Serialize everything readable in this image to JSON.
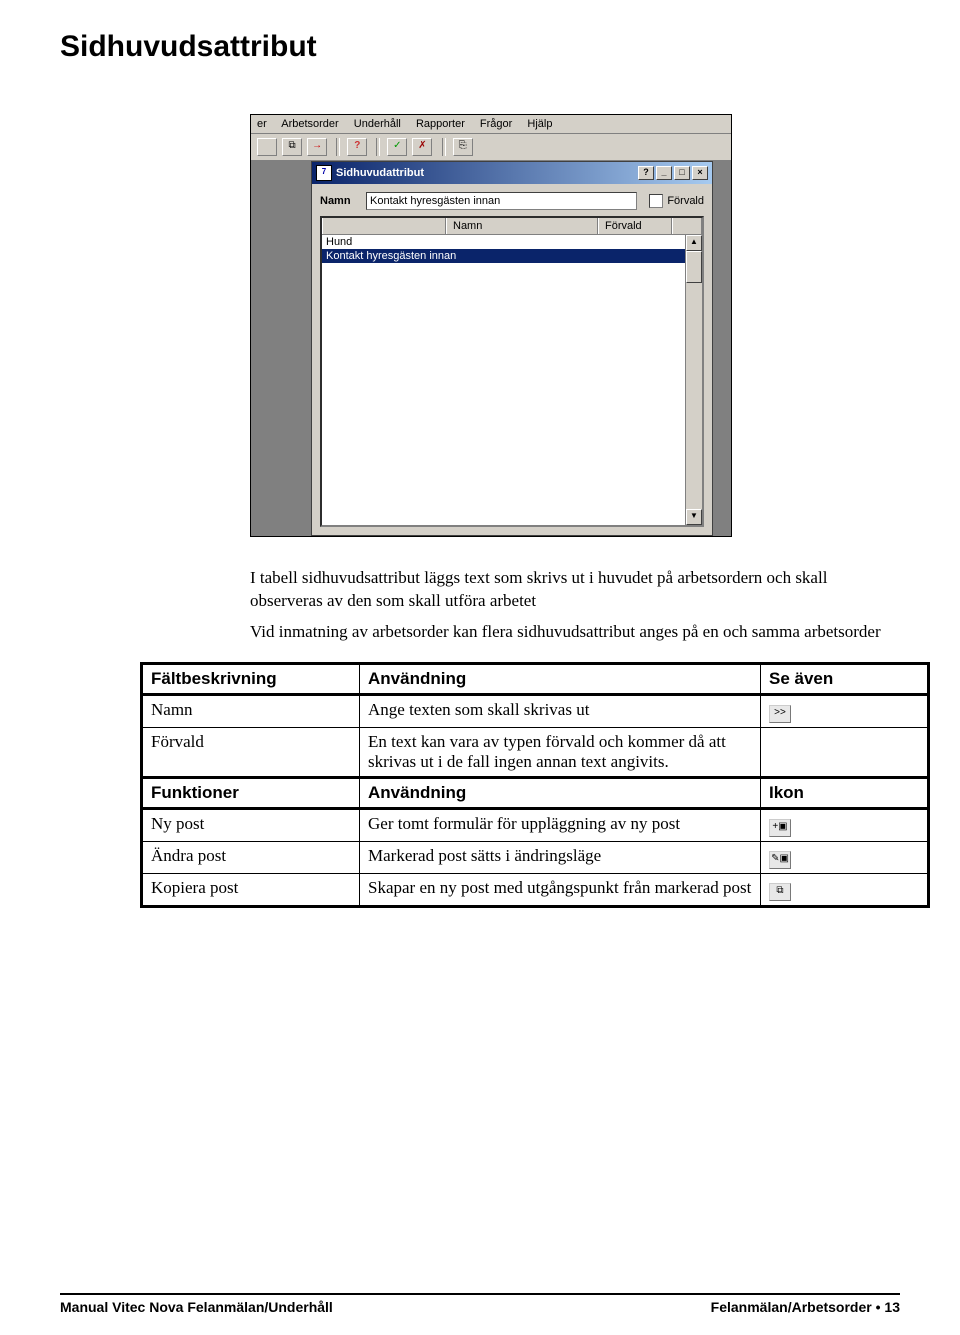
{
  "page_title": "Sidhuvudsattribut",
  "screenshot": {
    "menubar": [
      "er",
      "Arbetsorder",
      "Underhåll",
      "Rapporter",
      "Frågor",
      "Hjälp"
    ],
    "dialog": {
      "title": "Sidhuvudattribut",
      "icon_text": "7",
      "name_label": "Namn",
      "name_value": "Kontakt hyresgästen innan",
      "forvald_label": "Förvald",
      "list_headers": [
        "Namn",
        "Förvald"
      ],
      "list_rows": [
        {
          "name": "Hund",
          "selected": false
        },
        {
          "name": "Kontakt hyresgästen innan",
          "selected": true
        }
      ]
    }
  },
  "body": {
    "p1": "I tabell sidhuvudsattribut läggs text som skrivs ut i huvudet på arbetsordern och skall observeras av den som skall utföra arbetet",
    "p2": "Vid inmatning av arbetsorder kan flera sidhuvudsattribut anges på en och samma arbetsorder"
  },
  "table1": {
    "headers": [
      "Fältbeskrivning",
      "Användning",
      "Se även"
    ],
    "rows": [
      {
        "c1": "Namn",
        "c2": "Ange texten som skall skrivas ut",
        "icon": ">>"
      },
      {
        "c1": "Förvald",
        "c2": "En text kan vara av typen förvald och kommer då att skrivas ut i de fall ingen annan text angivits.",
        "icon": ""
      }
    ]
  },
  "table2": {
    "headers": [
      "Funktioner",
      "Användning",
      "Ikon"
    ],
    "rows": [
      {
        "c1": "Ny post",
        "c2": "Ger tomt formulär för uppläggning av ny post",
        "icon": "+▣"
      },
      {
        "c1": "Ändra post",
        "c2": "Markerad post sätts i ändringsläge",
        "icon": "✎▣"
      },
      {
        "c1": "Kopiera post",
        "c2": "Skapar en ny post med utgångspunkt från markerad post",
        "icon": "⧉"
      }
    ]
  },
  "footer": {
    "left": "Manual Vitec Nova Felanmälan/Underhåll",
    "right_label": "Felanmälan/Arbetsorder",
    "right_sep": "•",
    "right_page": "13"
  }
}
